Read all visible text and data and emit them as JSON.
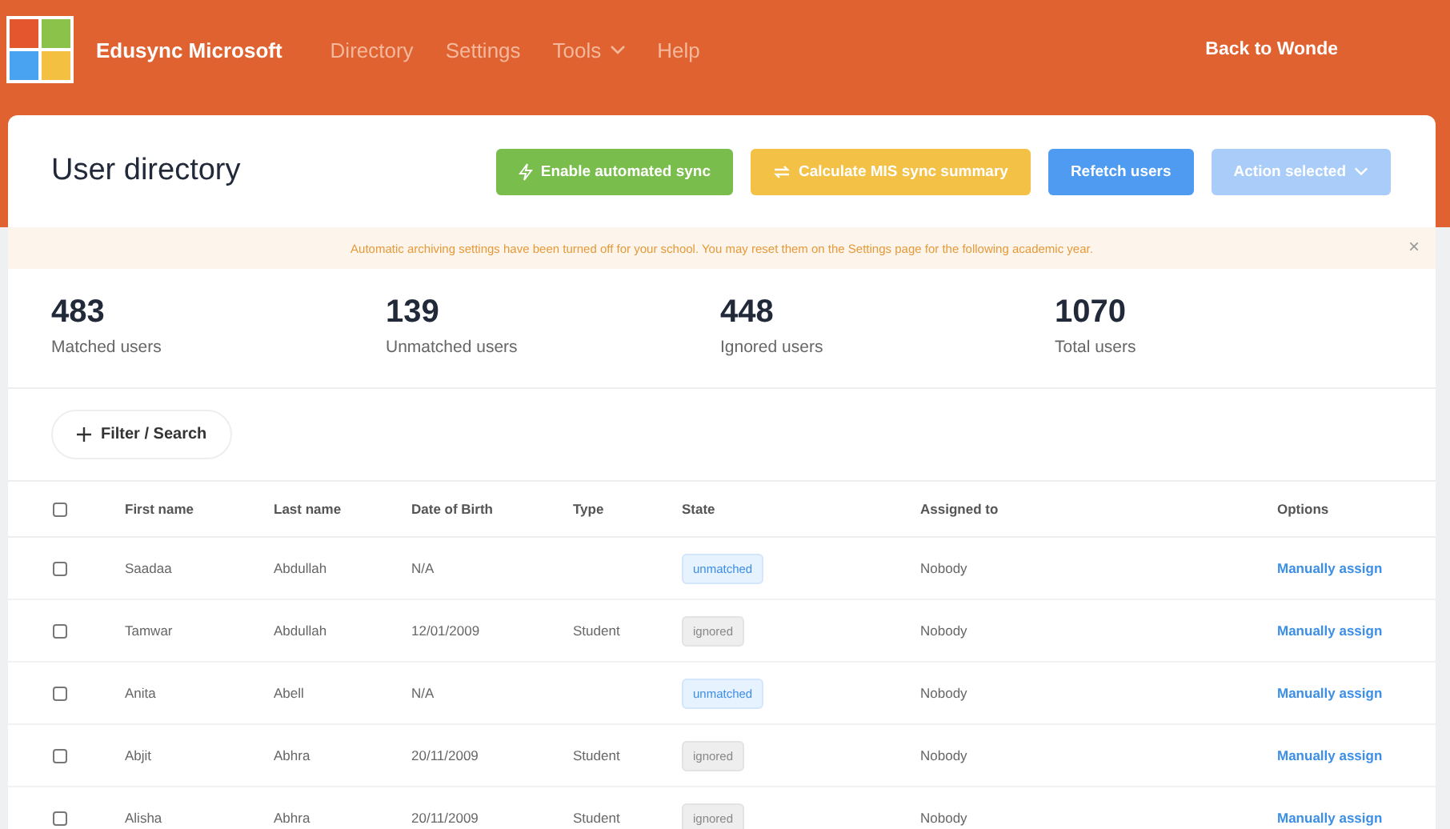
{
  "app": {
    "name": "Edusync Microsoft"
  },
  "nav": [
    {
      "label": "Directory",
      "dropdown": false
    },
    {
      "label": "Settings",
      "dropdown": false
    },
    {
      "label": "Tools",
      "dropdown": true
    },
    {
      "label": "Help",
      "dropdown": false
    }
  ],
  "back_link": "Back to Wonde",
  "page_title": "User directory",
  "actions": [
    {
      "label": "Enable automated sync",
      "kind": "enable",
      "disabled": false
    },
    {
      "label": "Calculate MIS sync summary",
      "kind": "calculate",
      "disabled": false
    },
    {
      "label": "Refetch users",
      "kind": "refetch",
      "disabled": false
    },
    {
      "label": "Action selected",
      "kind": "bulk",
      "disabled": true
    }
  ],
  "alert": {
    "text": "Automatic archiving settings have been turned off for your school. You may reset them on the Settings page for the following academic year.",
    "close": "×"
  },
  "stats": [
    {
      "value": "483",
      "label": "Matched users"
    },
    {
      "value": "139",
      "label": "Unmatched users"
    },
    {
      "value": "448",
      "label": "Ignored users"
    },
    {
      "value": "1070",
      "label": "Total users"
    }
  ],
  "filter_button": "Filter / Search",
  "table": {
    "select_all_checked": false,
    "columns": [
      "First name",
      "Last name",
      "Date of Birth",
      "Type",
      "State",
      "Assigned to",
      "Options"
    ],
    "rows": [
      {
        "checked": false,
        "first_name": "Saadaa",
        "last_name": "Abdullah",
        "dob": "N/A",
        "type": "",
        "state": {
          "label": "unmatched",
          "kind": "unmatched"
        },
        "assigned_to": "Nobody",
        "option": "Manually assign"
      },
      {
        "checked": false,
        "first_name": "Tamwar",
        "last_name": "Abdullah",
        "dob": "12/01/2009",
        "type": "Student",
        "state": {
          "label": "ignored",
          "kind": "ignored"
        },
        "assigned_to": "Nobody",
        "option": "Manually assign"
      },
      {
        "checked": false,
        "first_name": "Anita",
        "last_name": "Abell",
        "dob": "N/A",
        "type": "",
        "state": {
          "label": "unmatched",
          "kind": "unmatched"
        },
        "assigned_to": "Nobody",
        "option": "Manually assign"
      },
      {
        "checked": false,
        "first_name": "Abjit",
        "last_name": "Abhra",
        "dob": "20/11/2009",
        "type": "Student",
        "state": {
          "label": "ignored",
          "kind": "ignored"
        },
        "assigned_to": "Nobody",
        "option": "Manually assign"
      },
      {
        "checked": false,
        "first_name": "Alisha",
        "last_name": "Abhra",
        "dob": "20/11/2009",
        "type": "Student",
        "state": {
          "label": "ignored",
          "kind": "ignored"
        },
        "assigned_to": "Nobody",
        "option": "Manually assign"
      }
    ]
  }
}
